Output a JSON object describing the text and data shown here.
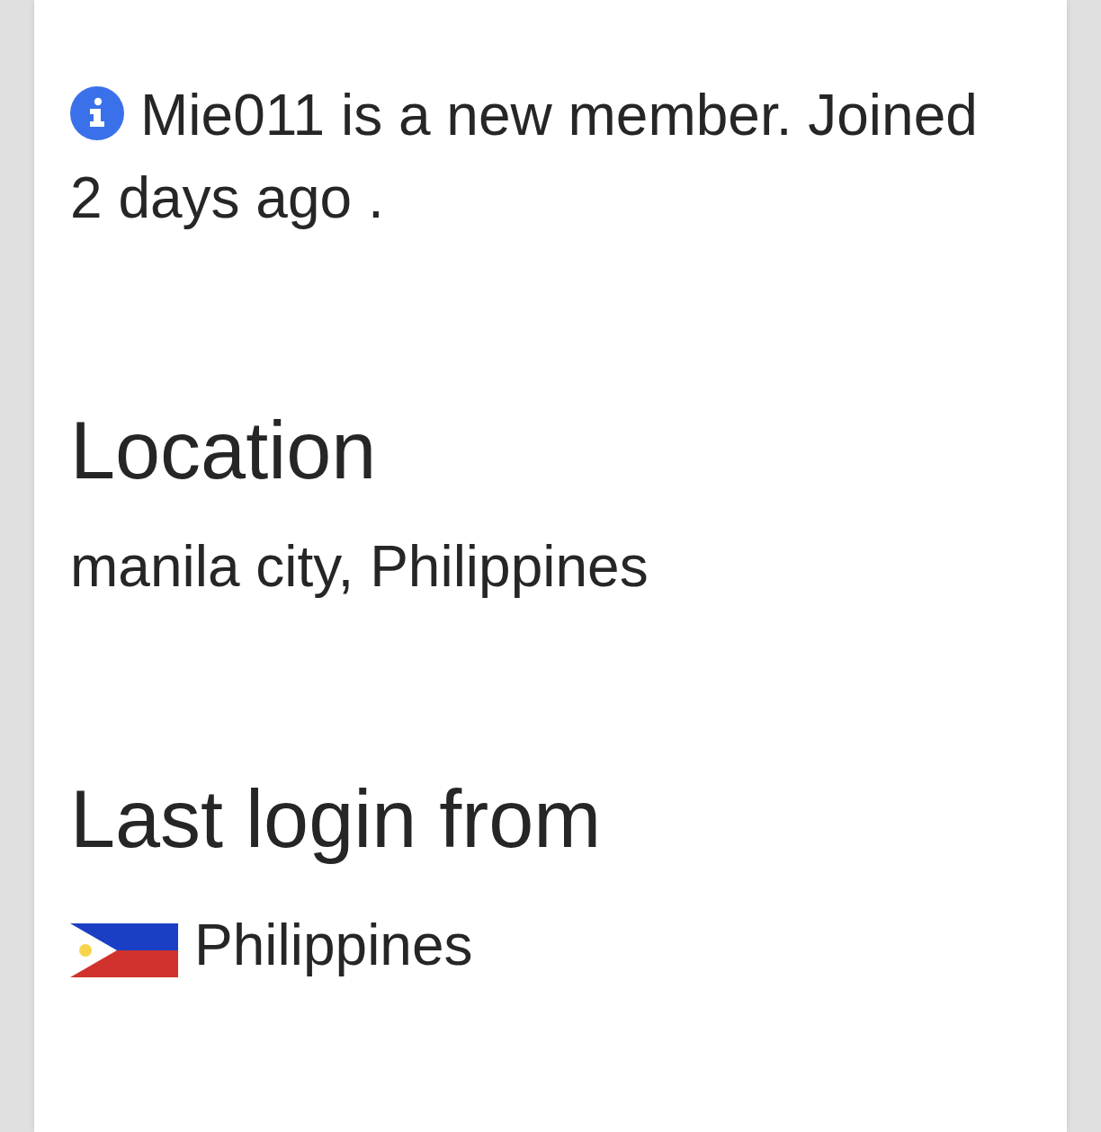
{
  "member_notice": {
    "text": "Mie011 is a new member. Joined",
    "joined_ago": "2 days ago ."
  },
  "sections": [
    {
      "heading": "Location",
      "kind": "text",
      "value": "manila city, Philippines"
    },
    {
      "heading": "Last login from",
      "kind": "flag",
      "value": "Philippines"
    }
  ]
}
